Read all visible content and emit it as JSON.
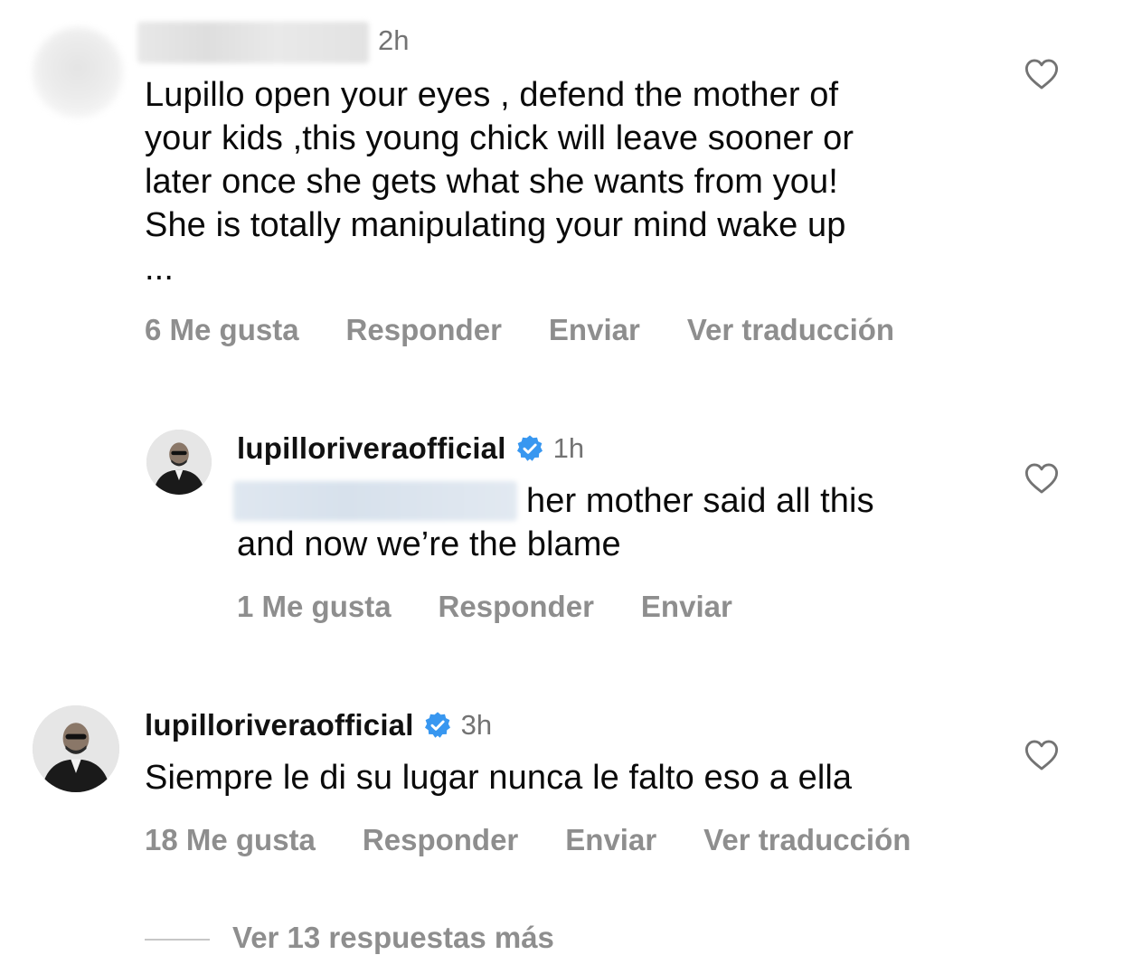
{
  "comments": [
    {
      "time": "2h",
      "text_lines": [
        "Lupillo open your eyes , defend the mother of",
        "your kids ,this young chick will leave sooner or",
        "later once she gets what she wants from you!",
        "She is totally manipulating your mind wake up",
        "..."
      ],
      "likes": "6 Me gusta",
      "reply": "Responder",
      "send": "Enviar",
      "translate": "Ver traducción"
    },
    {
      "username": "lupilloriveraofficial",
      "time": "1h",
      "text_line1": "her mother said all this",
      "text_line2": "and now we’re the blame",
      "likes": "1 Me gusta",
      "reply": "Responder",
      "send": "Enviar"
    },
    {
      "username": "lupilloriveraofficial",
      "time": "3h",
      "text": "Siempre le di su lugar nunca le falto eso a ella",
      "likes": "18 Me gusta",
      "reply": "Responder",
      "send": "Enviar",
      "translate": "Ver traducción"
    }
  ],
  "more_replies": "Ver 13 respuestas más",
  "icons": {
    "heart": "heart-outline-icon",
    "verified": "verified-badge-icon"
  },
  "colors": {
    "verified": "#3897f0",
    "secondary_text": "#8e8e8e"
  }
}
